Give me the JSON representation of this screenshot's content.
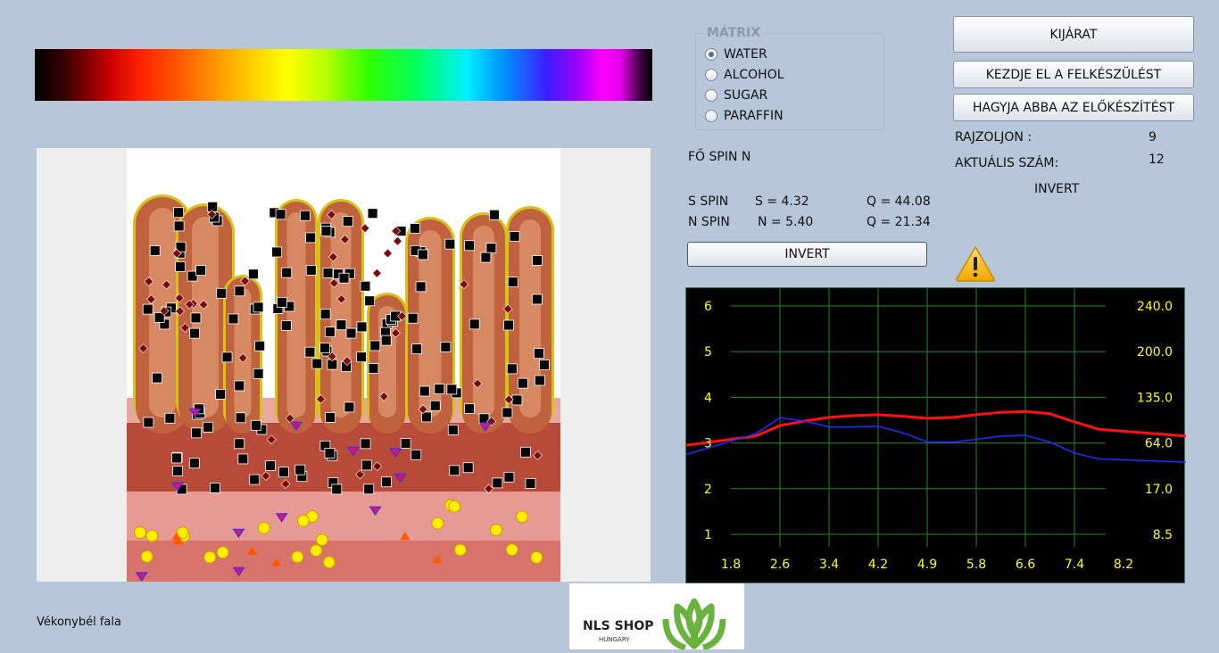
{
  "caption": "Vékonybél fala",
  "matrix": {
    "legend": "MÁTRIX",
    "options": [
      "WATER",
      "ALCOHOL",
      "SUGAR",
      "PARAFFIN"
    ],
    "selected": "WATER"
  },
  "buttons": {
    "exit": "KIJÁRAT",
    "start": "KEZDJE EL A FELKÉSZÜLÉST",
    "stop": "HAGYJA ABBA AZ ELŐKÉSZÍTÉST",
    "invert": "INVERT"
  },
  "stats": {
    "draw_label": "RAJZOLJON :",
    "draw_value": "9",
    "current_label": "AKTUÁLIS SZÁM:",
    "current_value": "12",
    "invert_text": "INVERT"
  },
  "spin": {
    "main_label": "FŐ SPIN N",
    "s_label": "S SPIN",
    "s_value": "S = 4.32",
    "s_q": "Q = 44.08",
    "n_label": "N SPIN",
    "n_value": "N = 5.40",
    "n_q": "Q = 21.34"
  },
  "warning_icon": "warning-triangle-icon",
  "colors": {
    "background": "#b8c6d9",
    "red_series": "#ff1010",
    "blue_series": "#1a2cff",
    "grid": "#1f8a1f",
    "tick_labels": "#ffff00"
  },
  "logo": {
    "name": "NLS SHOP",
    "sub": "HUNGARY"
  },
  "chart_data": {
    "type": "line",
    "x_ticks": [
      "1.8",
      "2.6",
      "3.4",
      "4.2",
      "4.9",
      "5.8",
      "6.6",
      "7.4",
      "8.2"
    ],
    "y_left_ticks": [
      "1",
      "2",
      "3",
      "4",
      "5",
      "6"
    ],
    "y_right_ticks": [
      "8.5",
      "17.0",
      "64.0",
      "135.0",
      "200.0",
      "240.0"
    ],
    "ylim": [
      1,
      6
    ],
    "grid": true,
    "series": [
      {
        "color": "#ff1010",
        "x": [
          1.8,
          2.2,
          2.6,
          3.0,
          3.4,
          3.8,
          4.2,
          4.6,
          4.9,
          5.4,
          5.8,
          6.2,
          6.6,
          7.0,
          7.4,
          7.8,
          8.2
        ],
        "y": [
          2.95,
          3.15,
          3.38,
          3.48,
          3.56,
          3.6,
          3.62,
          3.58,
          3.54,
          3.56,
          3.62,
          3.67,
          3.69,
          3.64,
          3.46,
          3.3,
          3.15
        ]
      },
      {
        "color": "#1a2cff",
        "x": [
          1.8,
          2.2,
          2.6,
          3.0,
          3.4,
          3.8,
          4.2,
          4.6,
          4.9,
          5.4,
          5.8,
          6.2,
          6.6,
          7.0,
          7.4,
          7.8,
          8.2
        ],
        "y": [
          2.75,
          3.2,
          3.55,
          3.48,
          3.35,
          3.35,
          3.37,
          3.2,
          3.02,
          3.02,
          3.08,
          3.15,
          3.17,
          3.02,
          2.78,
          2.65,
          2.58
        ]
      }
    ]
  }
}
